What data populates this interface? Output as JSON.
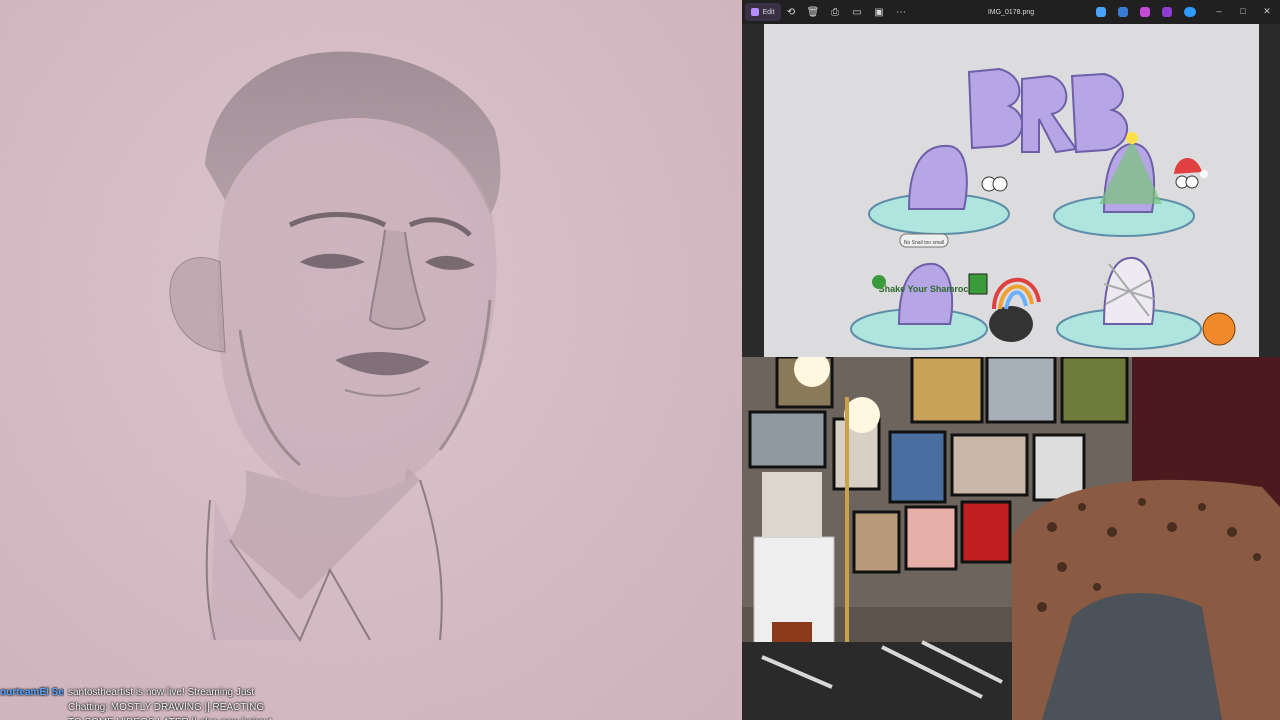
{
  "chat": {
    "username": "ourteamEl Semonia",
    "message": "santostheartist is now live! Streaming Just Chatting: MOSTLY DRAWING || REACTING TO SOME VIDEOS LATER || also new haircut c:"
  },
  "viewer": {
    "edit_label": "Edit",
    "filename": "IMG_0178.png",
    "brb_text": "BRB",
    "sign_text": "No Snail too small",
    "shell_text": "Shake Your Shamrock",
    "accent": "#b68cff"
  },
  "icons": {
    "rotate": "rotate-icon",
    "delete": "delete-icon",
    "print": "print-icon",
    "crop": "crop-icon",
    "more": "more-icon",
    "minimize": "minimize-icon",
    "maximize": "maximize-icon",
    "close": "close-icon"
  }
}
